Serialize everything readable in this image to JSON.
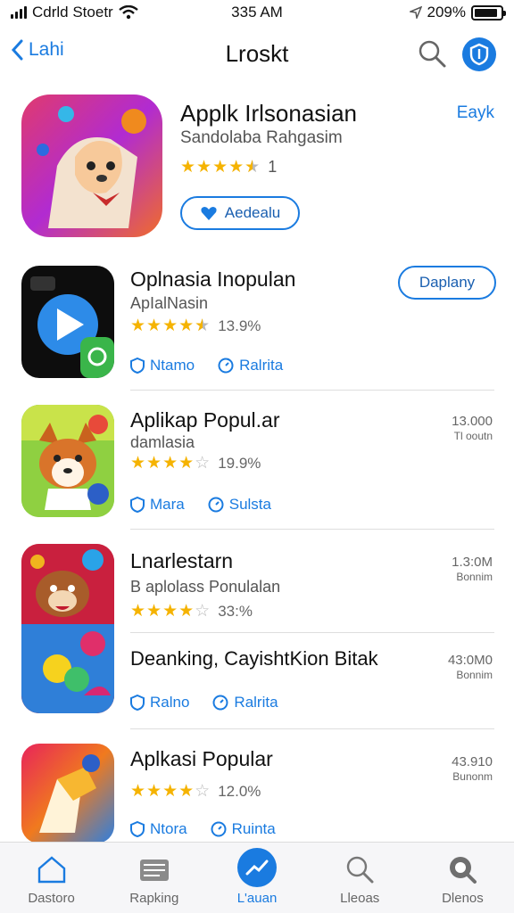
{
  "status": {
    "carrier": "Cdrld Stoetr",
    "time": "335 AM",
    "battery_text": "209%",
    "battery_level": 0.9
  },
  "nav": {
    "back_label": "Lahi",
    "title": "Lroskt"
  },
  "featured": {
    "title": "Applk Irlsonasian",
    "subtitle": "Sandolaba Rahgasim",
    "rating": 4.5,
    "rating_text": "1",
    "link": "Eayk",
    "button_label": "Aedealu"
  },
  "items": [
    {
      "title": "Oplnasia Inopulan",
      "subtitle": "ApIalNasin",
      "rating": 4.5,
      "rating_text": "13.9%",
      "button_label": "Daplany",
      "chips": [
        "Ntamo",
        "Ralrita"
      ],
      "icon_name": "play-icon"
    },
    {
      "title": "Aplikap Popul.ar",
      "subtitle": "damlasia",
      "rating": 4,
      "rating_text": "19.9%",
      "meta_value": "13.000",
      "meta_sub": "Tl ooutn",
      "chips": [
        "Mara",
        "Sulsta"
      ],
      "icon_name": "dog-icon"
    },
    {
      "title": "Lnarlestarn",
      "subtitle": "B aplolass Ponulalan",
      "rating": 4,
      "rating_text": "33:%",
      "meta_value": "1.3:0M",
      "meta_sub": "Bonnim",
      "chips": [
        "Ralno",
        "Ralrita"
      ],
      "icon_name": "cartoon-icon",
      "extra_line": "Deanking, CayishtKion Bitak",
      "extra_meta_value": "43:0M0",
      "extra_meta_sub": "Bonnim"
    },
    {
      "title": "Aplkasi Popular",
      "subtitle": "",
      "rating": 4,
      "rating_text": "12.0%",
      "meta_value": "43.910",
      "meta_sub": "Bunonm",
      "chips": [
        "Ntora",
        "Ruinta"
      ],
      "icon_name": "bookmark-icon"
    }
  ],
  "tabs": [
    {
      "label": "Dastoro",
      "icon": "home-icon",
      "active": false
    },
    {
      "label": "Rapking",
      "icon": "ranking-icon",
      "active": false
    },
    {
      "label": "L'auan",
      "icon": "trend-icon",
      "active": true
    },
    {
      "label": "Lleoas",
      "icon": "search-icon",
      "active": false
    },
    {
      "label": "Dlenos",
      "icon": "profile-search-icon",
      "active": false
    }
  ],
  "colors": {
    "accent": "#1a7be0",
    "star": "#f5b301"
  }
}
